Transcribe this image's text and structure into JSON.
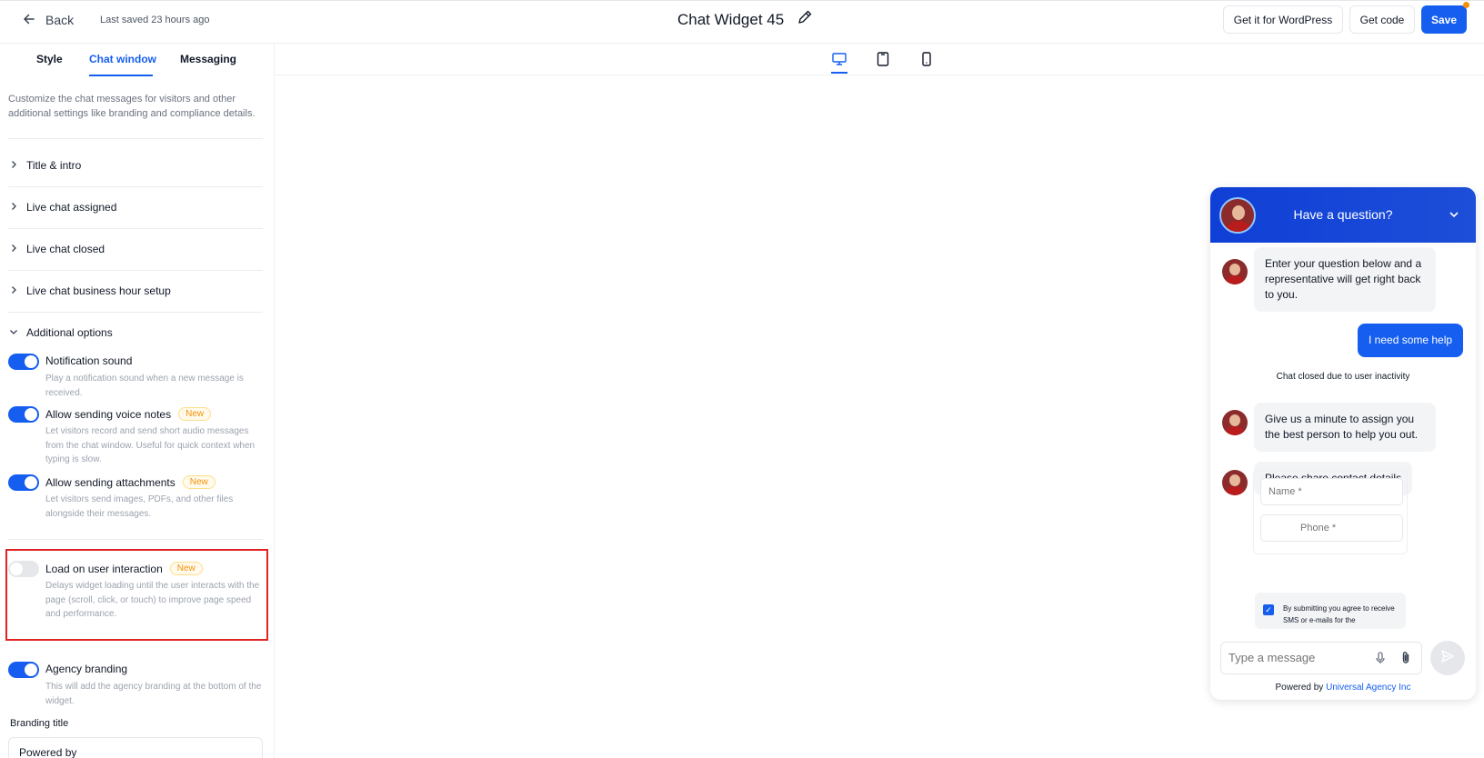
{
  "header": {
    "back_label": "Back",
    "last_saved": "Last saved 23 hours ago",
    "title": "Chat Widget 45",
    "btn_wordpress": "Get it for WordPress",
    "btn_code": "Get code",
    "btn_save": "Save"
  },
  "tabs": [
    {
      "label": "Style"
    },
    {
      "label": "Chat window"
    },
    {
      "label": "Messaging"
    }
  ],
  "description": "Customize the chat messages for visitors and other additional settings like branding and compliance details.",
  "sections": [
    {
      "label": "Title & intro"
    },
    {
      "label": "Live chat assigned"
    },
    {
      "label": "Live chat closed"
    },
    {
      "label": "Live chat business hour setup"
    },
    {
      "label": "Additional options"
    }
  ],
  "options": [
    {
      "title": "Notification sound",
      "badge": "",
      "desc": "Play a notification sound when a new message is received.",
      "enabled": true
    },
    {
      "title": "Allow sending voice notes",
      "badge": "New",
      "desc": "Let visitors record and send short audio messages from the chat window. Useful for quick context when typing is slow.",
      "enabled": true
    },
    {
      "title": "Allow sending attachments",
      "badge": "New",
      "desc": "Let visitors send images, PDFs, and other files alongside their messages.",
      "enabled": true
    },
    {
      "title": "Load on user interaction",
      "badge": "New",
      "desc": "Delays widget loading until the user interacts with the page (scroll, click, or touch) to improve page speed and performance.",
      "enabled": false
    },
    {
      "title": "Agency branding",
      "badge": "",
      "desc": "This will add the agency branding at the bottom of the widget.",
      "enabled": true
    }
  ],
  "branding": {
    "label": "Branding title",
    "value": "Powered by"
  },
  "widget": {
    "header_title": "Have a question?",
    "messages": [
      {
        "from": "agent",
        "text": "Enter your question below and a representative will get right back to you."
      },
      {
        "from": "visitor",
        "text": "I need some help"
      },
      {
        "from": "system",
        "text": "Chat closed due to user inactivity"
      },
      {
        "from": "agent",
        "text": "Give us a minute to assign you the best person to help you out."
      },
      {
        "from": "agent",
        "text": "Please share contact details"
      }
    ],
    "form": {
      "name_placeholder": "Name *",
      "phone_placeholder": "Phone *",
      "consent_text": "By submitting you agree to receive SMS or e-mails for the"
    },
    "input_placeholder": "Type a message",
    "powered_by": "Powered by",
    "agency_name": "Universal Agency Inc"
  },
  "colors": {
    "accent": "#155eef",
    "badge": "#f79009",
    "highlight": "#e02424"
  },
  "icons": [
    "arrow-left-icon",
    "pencil-icon",
    "chevron-right-icon",
    "chevron-down-icon",
    "desktop-icon",
    "tablet-icon",
    "mobile-icon",
    "microphone-icon",
    "paperclip-icon",
    "send-icon"
  ]
}
